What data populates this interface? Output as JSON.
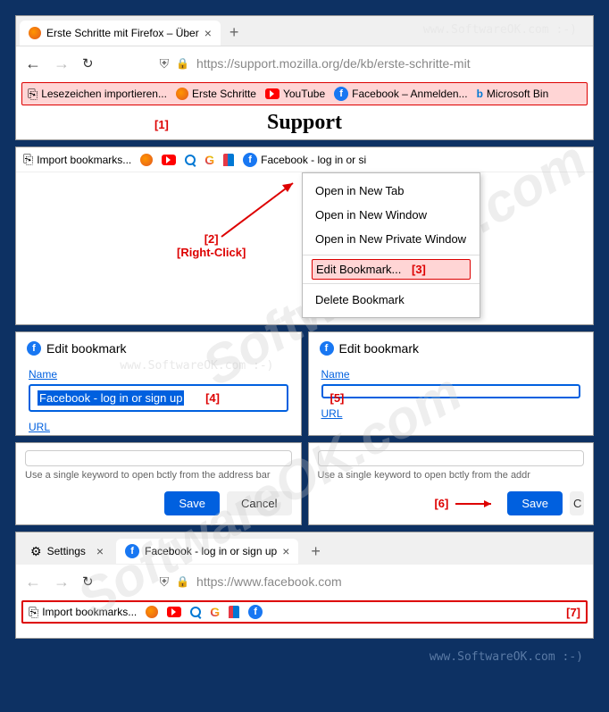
{
  "watermark": "www.SoftwareOK.com :-)",
  "panel1": {
    "tab_title": "Erste Schritte mit Firefox – Über",
    "url": "https://support.mozilla.org/de/kb/erste-schritte-mit",
    "bookmarks": {
      "import": "Lesezeichen importieren...",
      "start": "Erste Schritte",
      "youtube": "YouTube",
      "facebook": "Facebook – Anmelden...",
      "bing": "Microsoft Bin"
    },
    "heading": "Support",
    "anno1": "[1]"
  },
  "panel2": {
    "import": "Import bookmarks...",
    "fb_text": "Facebook - log in or si",
    "menu": {
      "new_tab": "Open in New Tab",
      "new_win": "Open in New Window",
      "new_priv": "Open in New Private Window",
      "edit": "Edit Bookmark...",
      "delete": "Delete Bookmark"
    },
    "anno2": "[2]",
    "anno2b": "[Right-Click]",
    "anno3": "[3]"
  },
  "panel3": {
    "title": "Edit bookmark",
    "name_label": "Name",
    "url_label": "URL",
    "name_value": "Facebook - log in or sign up",
    "anno4": "[4]",
    "anno5": "[5]"
  },
  "panel4": {
    "hint_left": "Use a single keyword to open bctly from the address bar",
    "hint_right": "Use a single keyword to open bctly from the addr",
    "save": "Save",
    "cancel": "Cancel",
    "anno6": "[6]"
  },
  "panel5": {
    "tab1": "Settings",
    "tab2": "Facebook - log in or sign up",
    "url": "https://www.facebook.com",
    "import": "Import bookmarks...",
    "anno7": "[7]"
  }
}
